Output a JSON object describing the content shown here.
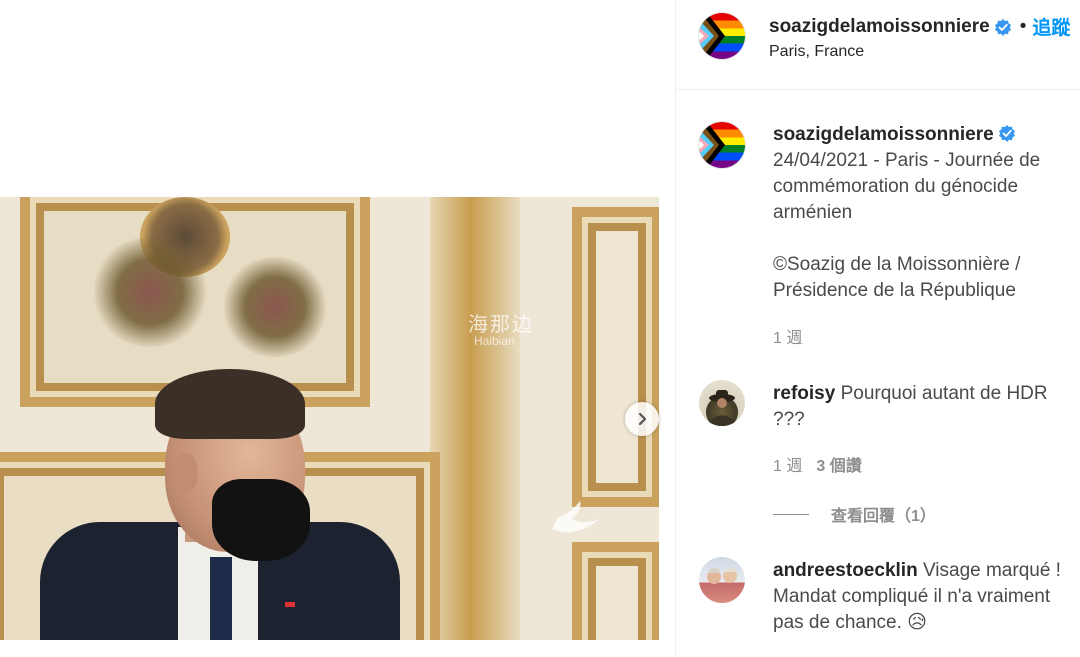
{
  "post": {
    "username": "soazigdelamoissonniere",
    "location": "Paris, France",
    "follow_label": "追蹤",
    "separator": "•"
  },
  "media": {
    "watermark_cn": "海那边",
    "watermark_latin": "Haibian",
    "next_icon": "chevron-right-icon"
  },
  "caption": {
    "username": "soazigdelamoissonniere",
    "line1": "24/04/2021 - Paris - Journée de commémoration du génocide arménien",
    "line2": "©Soazig de la Moissonnière / Présidence de la République",
    "time": "1 週"
  },
  "comments": [
    {
      "username": "refoisy",
      "text": "Pourquoi autant de HDR ???",
      "time": "1 週",
      "likes": "3 個讚",
      "view_replies": "查看回覆（1）"
    },
    {
      "username": "andreestoecklin",
      "text": "Visage marqué ! Mandat compliqué il n'a vraiment pas de chance. 😥"
    }
  ],
  "colors": {
    "link_blue": "#0095f6",
    "verified_blue": "#3897f0",
    "muted_text": "#8e8e8e"
  }
}
